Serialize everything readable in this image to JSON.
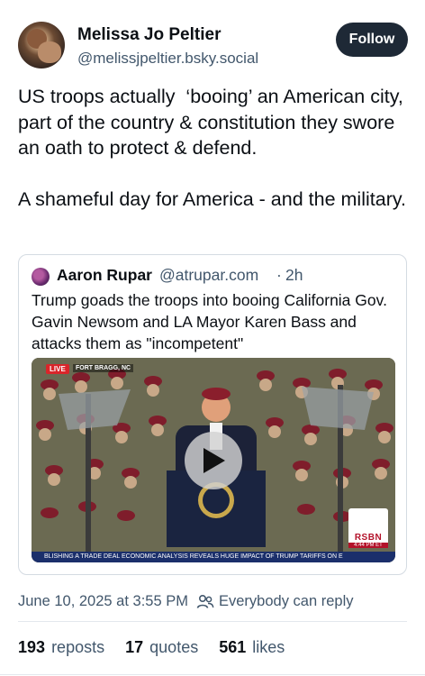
{
  "post": {
    "author_name": "Melissa Jo Peltier",
    "author_handle": "@melissjpeltier.bsky.social",
    "follow_label": "Follow",
    "text": "US troops actually  ‘booing’ an American city, part of the country & constitution they swore an oath to protect & defend.\n\nA shameful day for America - and the military."
  },
  "quote": {
    "author_name": "Aaron Rupar",
    "author_handle": "@atrupar.com",
    "separator": "·",
    "time": "2h",
    "text": "Trump goads the troops into booing California Gov. Gavin Newsom and LA Mayor Karen Bass and attacks them as \"incompetent\"",
    "video": {
      "live_badge": "LIVE",
      "location": "FORT BRAGG, NC",
      "ticker": "BLISHING A TRADE DEAL    ECONOMIC ANALYSIS REVEALS HUGE IMPACT OF TRUMP TARIFFS ON E",
      "network_logo": "RSBN",
      "network_time": "4:44 PM ET",
      "play_icon": "play-icon"
    }
  },
  "footer": {
    "date": "June 10, 2025 at 3:55 PM",
    "reply_setting": "Everybody can reply",
    "reply_icon": "people-icon",
    "reposts_count": "193",
    "reposts_label": "reposts",
    "quotes_count": "17",
    "quotes_label": "quotes",
    "likes_count": "561",
    "likes_label": "likes"
  },
  "colors": {
    "text": "#0b0f14",
    "muted": "#42576c",
    "follow_bg": "#1e2936",
    "border": "#d4dbe2"
  }
}
